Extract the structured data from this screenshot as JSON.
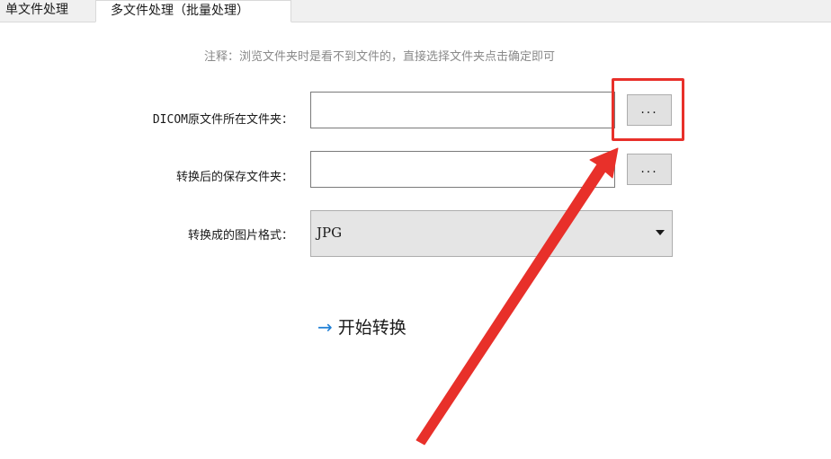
{
  "tabs": [
    {
      "label": "单文件处理",
      "active": false
    },
    {
      "label": "多文件处理（批量处理）",
      "active": true
    }
  ],
  "note": "注释：浏览文件夹时是看不到文件的，直接选择文件夹点击确定即可",
  "source_folder": {
    "label": "DICOM原文件所在文件夹：",
    "value": "",
    "browse_label": "..."
  },
  "output_folder": {
    "label": "转换后的保存文件夹：",
    "value": "",
    "browse_label": "..."
  },
  "format": {
    "label": "转换成的图片格式：",
    "selected": "JPG"
  },
  "start": {
    "arrow": "→",
    "label": "开始转换"
  },
  "colors": {
    "highlight": "#e8302a",
    "link_arrow": "#1e7fd6",
    "tab_bg": "#f0f0f0"
  },
  "icons": {
    "caret": "chevron-down-icon",
    "annotation": "annotation-arrow-icon"
  }
}
